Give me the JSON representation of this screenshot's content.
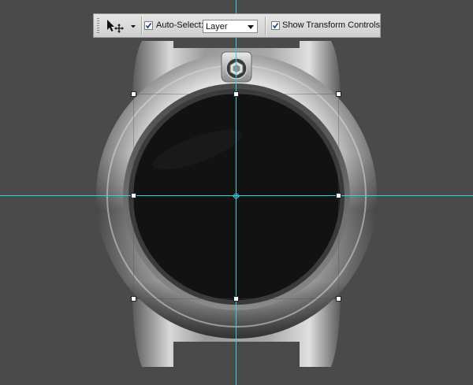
{
  "options_bar": {
    "tool_icon": "move-tool-icon",
    "auto_select": {
      "label": "Auto-Select:",
      "checked": true
    },
    "auto_select_target": {
      "value": "Layer"
    },
    "show_transform_controls": {
      "label": "Show Transform Controls",
      "checked": true
    }
  },
  "canvas": {
    "background_color": "#4a4a4a",
    "guide_color": "#27d7dd"
  }
}
